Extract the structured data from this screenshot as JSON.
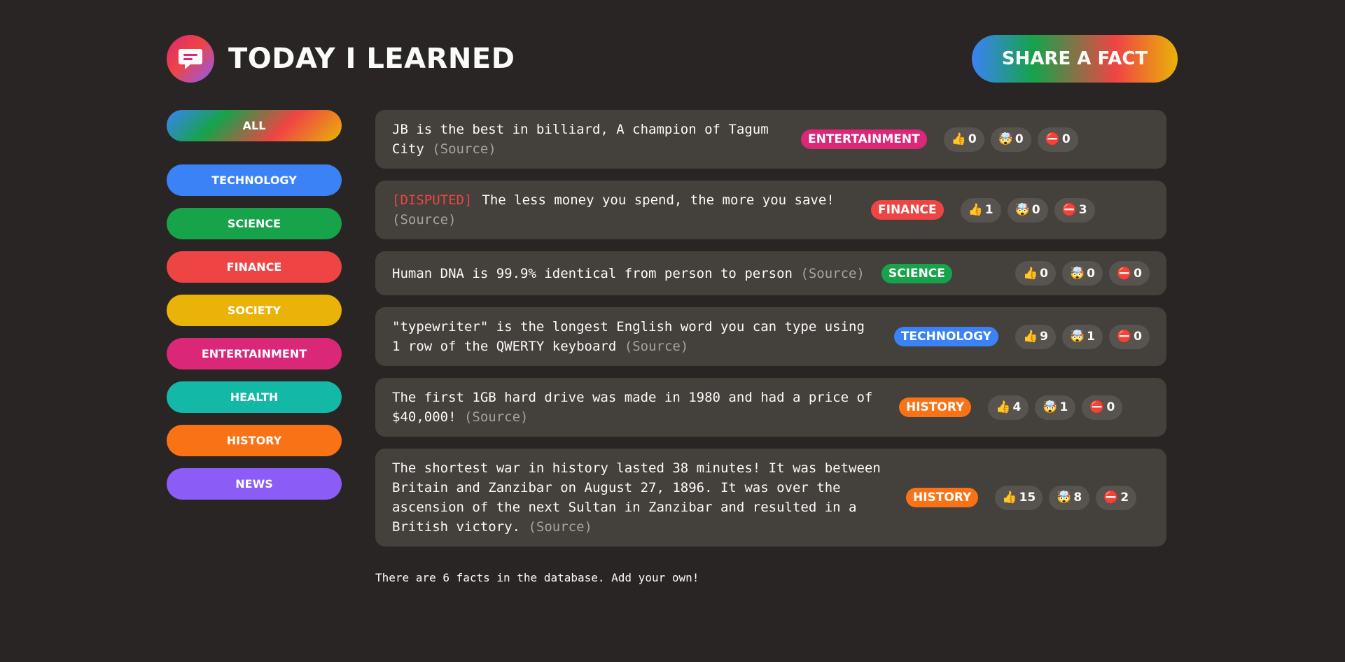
{
  "header": {
    "title": "Today I Learned",
    "share_label": "Share a fact"
  },
  "colors": {
    "technology": "#3b82f6",
    "science": "#16a34a",
    "finance": "#ef4444",
    "society": "#eab308",
    "entertainment": "#db2777",
    "health": "#14b8a6",
    "history": "#f97316",
    "news": "#8b5cf6"
  },
  "sidebar": {
    "all_label": "All",
    "items": [
      {
        "label": "Technology",
        "color": "#3b82f6"
      },
      {
        "label": "Science",
        "color": "#16a34a"
      },
      {
        "label": "Finance",
        "color": "#ef4444"
      },
      {
        "label": "Society",
        "color": "#eab308"
      },
      {
        "label": "Entertainment",
        "color": "#db2777"
      },
      {
        "label": "Health",
        "color": "#14b8a6"
      },
      {
        "label": "History",
        "color": "#f97316"
      },
      {
        "label": "News",
        "color": "#8b5cf6"
      }
    ]
  },
  "vote_icons": {
    "interesting": "👍",
    "mindblowing": "🤯",
    "false": "⛔"
  },
  "facts": [
    {
      "disputed": "",
      "text": "JB is the best in billiard, A champion of Tagum City",
      "source": "(Source)",
      "category": "Entertainment",
      "color": "#db2777",
      "interesting": "0",
      "mindblowing": "0",
      "false": "0"
    },
    {
      "disputed": "[DISPUTED]",
      "text": "The less money you spend, the more you save!",
      "source": "(Source)",
      "category": "Finance",
      "color": "#ef4444",
      "interesting": "1",
      "mindblowing": "0",
      "false": "3"
    },
    {
      "disputed": "",
      "text": "Human DNA is 99.9% identical from person to person",
      "source": "(Source)",
      "category": "Science",
      "color": "#16a34a",
      "interesting": "0",
      "mindblowing": "0",
      "false": "0"
    },
    {
      "disputed": "",
      "text": "\"typewriter\" is the longest English word you can type using 1 row of the QWERTY keyboard",
      "source": "(Source)",
      "category": "Technology",
      "color": "#3b82f6",
      "interesting": "9",
      "mindblowing": "1",
      "false": "0"
    },
    {
      "disputed": "",
      "text": "The first 1GB hard drive was made in 1980 and had a price of $40,000!",
      "source": "(Source)",
      "category": "History",
      "color": "#f97316",
      "interesting": "4",
      "mindblowing": "1",
      "false": "0"
    },
    {
      "disputed": "",
      "text": "The shortest war in history lasted 38 minutes! It was between Britain and Zanzibar on August 27, 1896. It was over the ascension of the next Sultan in Zanzibar and resulted in a British victory.",
      "source": "(Source)",
      "category": "History",
      "color": "#f97316",
      "interesting": "15",
      "mindblowing": "8",
      "false": "2"
    }
  ],
  "footer": "There are 6 facts in the database. Add your own!"
}
